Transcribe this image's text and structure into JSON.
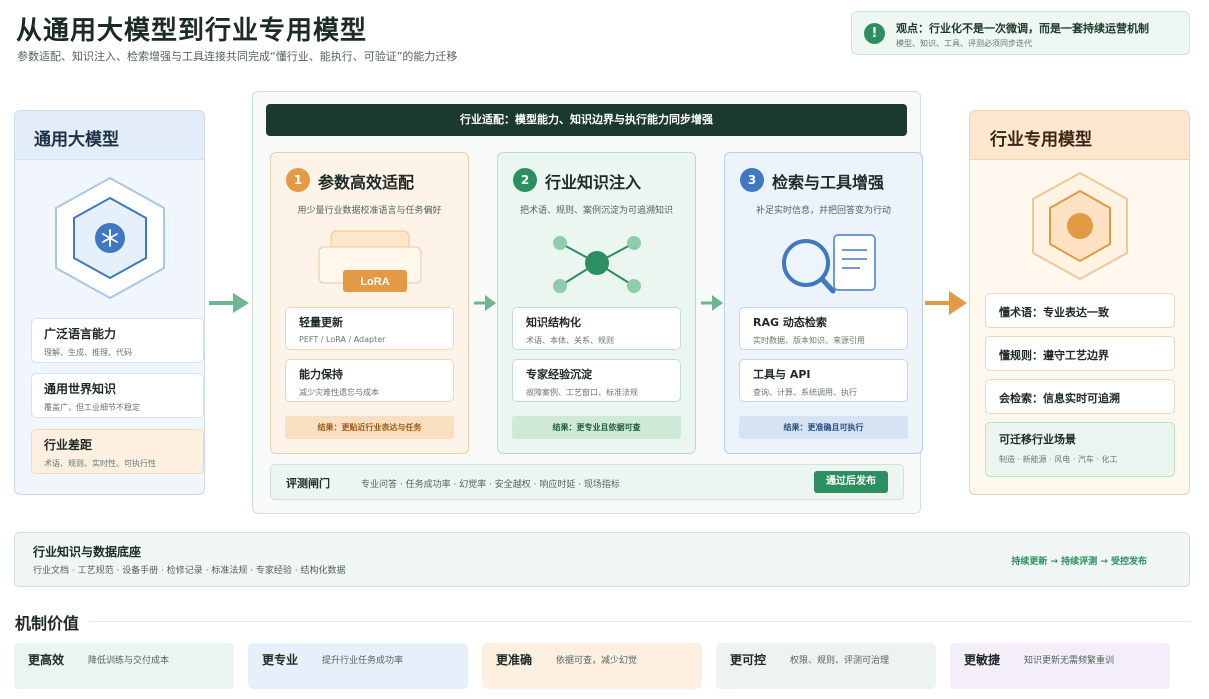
{
  "header": {
    "title": "从通用大模型到行业专用模型",
    "subtitle": "参数适配、知识注入、检索增强与工具连接共同完成“懂行业、能执行、可验证”的能力迁移"
  },
  "viewpoint": {
    "icon": "!",
    "title": "观点：行业化不是一次微调，而是一套持续运营机制",
    "subtitle": "模型、知识、工具、评测必须同步迭代"
  },
  "general_model": {
    "title": "通用大模型",
    "cards": [
      {
        "title": "广泛语言能力",
        "desc": "理解、生成、推理、代码"
      },
      {
        "title": "通用世界知识",
        "desc": "覆盖广，但工业细节不稳定"
      },
      {
        "title": "行业差距",
        "desc": "术语、规则、实时性、可执行性"
      }
    ]
  },
  "industry_adapt": {
    "banner": "行业适配：模型能力、知识边界与执行能力同步增强",
    "stages": [
      {
        "num": "1",
        "title": "参数高效适配",
        "desc": "用少量行业数据校准语言与任务偏好",
        "badge": "LoRA",
        "cards": [
          {
            "title": "轻量更新",
            "desc": "PEFT / LoRA / Adapter"
          },
          {
            "title": "能力保持",
            "desc": "减少灾难性遗忘与成本"
          }
        ],
        "result": "结果：更贴近行业表达与任务"
      },
      {
        "num": "2",
        "title": "行业知识注入",
        "desc": "把术语、规则、案例沉淀为可追溯知识",
        "cards": [
          {
            "title": "知识结构化",
            "desc": "术语、本体、关系、规则"
          },
          {
            "title": "专家经验沉淀",
            "desc": "故障案例、工艺窗口、标准法规"
          }
        ],
        "result": "结果：更专业且依据可查"
      },
      {
        "num": "3",
        "title": "检索与工具增强",
        "desc": "补足实时信息，并把回答变为行动",
        "cards": [
          {
            "title": "RAG 动态检索",
            "desc": "实时数据、版本知识、来源引用"
          },
          {
            "title": "工具与 API",
            "desc": "查询、计算、系统调用、执行"
          }
        ],
        "result": "结果：更准确且可执行"
      }
    ],
    "eval": {
      "title": "评测闸门",
      "desc": "专业问答 · 任务成功率 · 幻觉率 · 安全越权 · 响应时延 · 现场指标",
      "button": "通过后发布"
    }
  },
  "industry_model": {
    "title": "行业专用模型",
    "items": [
      {
        "text": "懂术语：专业表达一致"
      },
      {
        "text": "懂规则：遵守工艺边界"
      },
      {
        "text": "会检索：信息实时可追溯"
      }
    ],
    "scene": {
      "title": "可迁移行业场景",
      "desc": "制造 · 新能源 · 风电 · 汽车 · 化工"
    }
  },
  "data_base": {
    "title": "行业知识与数据底座",
    "desc": "行业文档 · 工艺规范 · 设备手册 · 检修记录 · 标准法规 · 专家经验 · 结构化数据",
    "flow": "持续更新 → 持续评测 → 受控发布"
  },
  "mechanism": {
    "title": "机制价值",
    "items": [
      {
        "title": "更高效",
        "desc": "降低训练与交付成本"
      },
      {
        "title": "更专业",
        "desc": "提升行业任务成功率"
      },
      {
        "title": "更准确",
        "desc": "依据可查，减少幻觉"
      },
      {
        "title": "更可控",
        "desc": "权限、规则、评测可治理"
      },
      {
        "title": "更敏捷",
        "desc": "知识更新无需频繁重训"
      }
    ]
  },
  "colors": {
    "green": "#2c8f61",
    "orange": "#e39a44",
    "blue": "#3f79c4",
    "dark_banner": "#1b3a2d"
  }
}
